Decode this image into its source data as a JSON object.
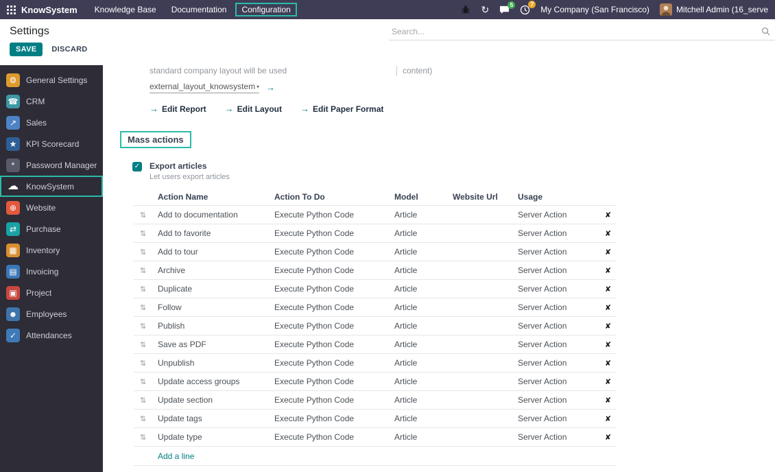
{
  "navbar": {
    "app_name": "KnowSystem",
    "menus": [
      {
        "label": "Knowledge Base",
        "highlighted": false
      },
      {
        "label": "Documentation",
        "highlighted": false
      },
      {
        "label": "Configuration",
        "highlighted": true
      }
    ],
    "messages_badge": "5",
    "activities_badge": "7",
    "company": "My Company (San Francisco)",
    "user": "Mitchell Admin (16_serve"
  },
  "panel": {
    "title": "Settings",
    "save_label": "SAVE",
    "discard_label": "DISCARD",
    "search_placeholder": "Search..."
  },
  "sidebar": {
    "items": [
      {
        "label": "General Settings",
        "glyph": "⚙",
        "color": "#dd9b2d",
        "highlighted": false
      },
      {
        "label": "CRM",
        "glyph": "☎",
        "color": "#3e98a5",
        "highlighted": false
      },
      {
        "label": "Sales",
        "glyph": "↗",
        "color": "#4d82c4",
        "highlighted": false
      },
      {
        "label": "KPI Scorecard",
        "glyph": "★",
        "color": "#2f5e96",
        "highlighted": false
      },
      {
        "label": "Password Manager",
        "glyph": "*",
        "color": "#585a6a",
        "highlighted": false
      },
      {
        "label": "KnowSystem",
        "glyph": "☁",
        "color": "transparent",
        "highlighted": true
      },
      {
        "label": "Website",
        "glyph": "⊕",
        "color": "#e2593d",
        "highlighted": false
      },
      {
        "label": "Purchase",
        "glyph": "⇄",
        "color": "#1aa2a4",
        "highlighted": false
      },
      {
        "label": "Inventory",
        "glyph": "▦",
        "color": "#d98f2e",
        "highlighted": false
      },
      {
        "label": "Invoicing",
        "glyph": "▤",
        "color": "#3a78b8",
        "highlighted": false
      },
      {
        "label": "Project",
        "glyph": "▣",
        "color": "#c9473e",
        "highlighted": false
      },
      {
        "label": "Employees",
        "glyph": "☻",
        "color": "#3f74ab",
        "highlighted": false
      },
      {
        "label": "Attendances",
        "glyph": "✓",
        "color": "#3f7ab8",
        "highlighted": false
      }
    ]
  },
  "content": {
    "truncated_left": "standard company layout will be used",
    "truncated_right": "content)",
    "layout_value": "external_layout_knowsystem",
    "edit_links": [
      {
        "label": "Edit Report"
      },
      {
        "label": "Edit Layout"
      },
      {
        "label": "Edit Paper Format"
      }
    ],
    "section_title": "Mass actions",
    "export_setting": {
      "label": "Export articles",
      "help": "Let users export articles",
      "checked": true
    },
    "table": {
      "headers": [
        "Action Name",
        "Action To Do",
        "Model",
        "Website Url",
        "Usage"
      ],
      "rows": [
        {
          "name": "Add to documentation",
          "action": "Execute Python Code",
          "model": "Article",
          "website": "",
          "usage": "Server Action"
        },
        {
          "name": "Add to favorite",
          "action": "Execute Python Code",
          "model": "Article",
          "website": "",
          "usage": "Server Action"
        },
        {
          "name": "Add to tour",
          "action": "Execute Python Code",
          "model": "Article",
          "website": "",
          "usage": "Server Action"
        },
        {
          "name": "Archive",
          "action": "Execute Python Code",
          "model": "Article",
          "website": "",
          "usage": "Server Action"
        },
        {
          "name": "Duplicate",
          "action": "Execute Python Code",
          "model": "Article",
          "website": "",
          "usage": "Server Action"
        },
        {
          "name": "Follow",
          "action": "Execute Python Code",
          "model": "Article",
          "website": "",
          "usage": "Server Action"
        },
        {
          "name": "Publish",
          "action": "Execute Python Code",
          "model": "Article",
          "website": "",
          "usage": "Server Action"
        },
        {
          "name": "Save as PDF",
          "action": "Execute Python Code",
          "model": "Article",
          "website": "",
          "usage": "Server Action"
        },
        {
          "name": "Unpublish",
          "action": "Execute Python Code",
          "model": "Article",
          "website": "",
          "usage": "Server Action"
        },
        {
          "name": "Update access groups",
          "action": "Execute Python Code",
          "model": "Article",
          "website": "",
          "usage": "Server Action"
        },
        {
          "name": "Update section",
          "action": "Execute Python Code",
          "model": "Article",
          "website": "",
          "usage": "Server Action"
        },
        {
          "name": "Update tags",
          "action": "Execute Python Code",
          "model": "Article",
          "website": "",
          "usage": "Server Action"
        },
        {
          "name": "Update type",
          "action": "Execute Python Code",
          "model": "Article",
          "website": "",
          "usage": "Server Action"
        }
      ],
      "add_line_label": "Add a line"
    }
  },
  "icons": {
    "drag": "⇅",
    "delete": "✘",
    "arrow": "→",
    "caret": "▾",
    "check": "✓",
    "refresh": "↻"
  },
  "colors": {
    "accent": "#017e84",
    "annotation": "#2abca9",
    "navbar_bg": "#3f3d56",
    "sidebar_bg": "#2d2c37",
    "messages_badge_bg": "#3cab4e",
    "activities_badge_bg": "#e9a825"
  }
}
